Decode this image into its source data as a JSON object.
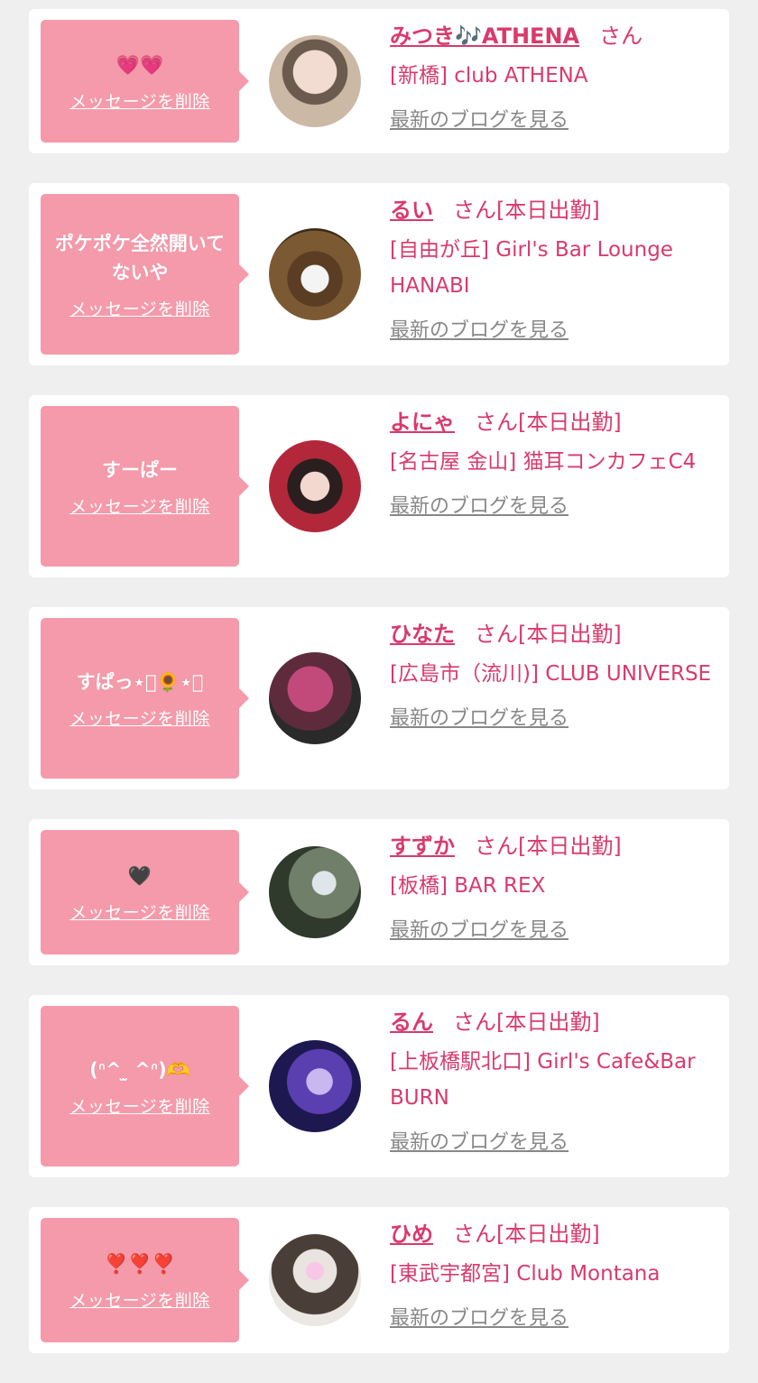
{
  "delete_label": "メッセージを削除",
  "blog_label": "最新のブログを見る",
  "colors": {
    "bubble": "#f59aaa",
    "name": "#d93a6c",
    "link": "#888888",
    "background": "#efefef"
  },
  "cards": [
    {
      "message": "💗💗",
      "name": "みつき🎶ATHENA",
      "suffix": "さん",
      "shop": "[新橋] club ATHENA"
    },
    {
      "message": "ポケポケ全然開いてないや",
      "name": "るい",
      "suffix": "さん[本日出勤]",
      "shop": "[自由が丘] Girl's Bar Lounge HANABI"
    },
    {
      "message": "すーぱー",
      "name": "よにゃ",
      "suffix": "さん[本日出勤]",
      "shop": "[名古屋 金山] 猫耳コンカフェC4"
    },
    {
      "message": "すぱっ⋆͛🌻⋆͛",
      "name": "ひなた",
      "suffix": "さん[本日出勤]",
      "shop": "[広島市（流川)] CLUB UNIVERSE"
    },
    {
      "message": "🖤",
      "name": "すずか",
      "suffix": "さん[本日出勤]",
      "shop": "[板橋] BAR REX"
    },
    {
      "message": "(ᐢ^ ̫ ^ᐢ)🫶",
      "name": "るん",
      "suffix": "さん[本日出勤]",
      "shop": "[上板橋駅北口] Girl's Cafe&Bar BURN"
    },
    {
      "message": "❣️❣️❣️",
      "name": "ひめ",
      "suffix": "さん[本日出勤]",
      "shop": "[東武宇都宮] Club Montana"
    }
  ]
}
